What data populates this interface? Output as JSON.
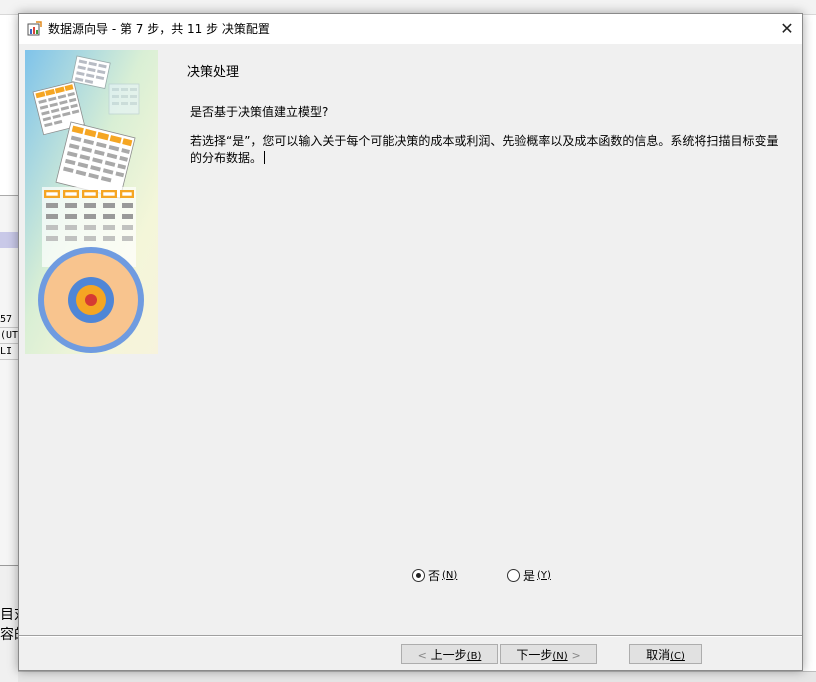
{
  "window": {
    "title": "数据源向导 - 第 7 步，共 11 步 决策配置",
    "close_glyph": "✕"
  },
  "content": {
    "section_title": "决策处理",
    "question": "是否基于决策值建立模型?",
    "description": "若选择“是”，您可以输入关于每个可能决策的成本或利润、先验概率以及成本函数的信息。系统将扫描目标变量的分布数据。"
  },
  "options": [
    {
      "label": "否",
      "shortcut": "(N)",
      "selected": true
    },
    {
      "label": "是",
      "shortcut": "(Y)",
      "selected": false
    }
  ],
  "buttons": {
    "back": {
      "arrow": "<",
      "label": "上一步",
      "shortcut": "(B)"
    },
    "next": {
      "label": "下一步",
      "shortcut": "(N)",
      "arrow": ">"
    },
    "cancel": {
      "label": "取消",
      "shortcut": "(C)"
    }
  },
  "background": {
    "left_rows": [
      "57",
      "(UT",
      "LI"
    ],
    "left_bottom": [
      "目对",
      "容的"
    ]
  },
  "colors": {
    "titlebar": "#ffffff",
    "dialog_bg": "#f0f0f0",
    "target_outer": "#6f9be0",
    "target_fill": "#f8c48e",
    "header_orange": "#f5a623"
  }
}
